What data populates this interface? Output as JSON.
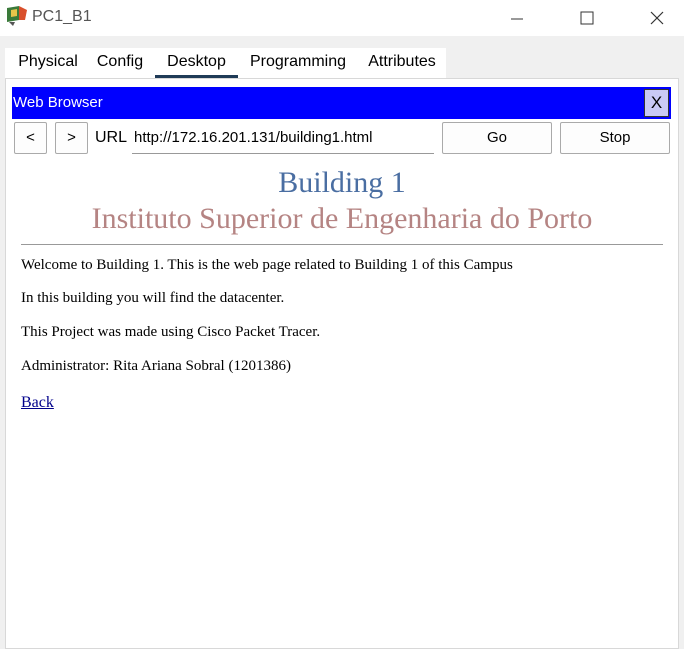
{
  "window": {
    "title": "PC1_B1"
  },
  "tabs": [
    {
      "label": "Physical"
    },
    {
      "label": "Config"
    },
    {
      "label": "Desktop"
    },
    {
      "label": "Programming"
    },
    {
      "label": "Attributes"
    }
  ],
  "active_tab": "Desktop",
  "browser": {
    "title": "Web Browser",
    "close_label": "X",
    "back_label": "<",
    "forward_label": ">",
    "url_label": "URL",
    "url": "http://172.16.201.131/building1.html",
    "go_label": "Go",
    "stop_label": "Stop"
  },
  "page": {
    "heading": "Building 1",
    "subheading": "Instituto Superior de Engenharia do Porto",
    "paragraphs": [
      "Welcome to Building 1. This is the web page related to Building 1 of this Campus",
      "In this building you will find the datacenter.",
      "This Project was made using Cisco Packet Tracer.",
      "Administrator: Rita Ariana Sobral (1201386)"
    ],
    "back_link": "Back"
  },
  "colors": {
    "browser_bar": "#0000ff",
    "heading": "#4a6ea2",
    "subheading": "#b58483",
    "link": "#00008b",
    "active_tab_underline": "#1f3b57"
  }
}
